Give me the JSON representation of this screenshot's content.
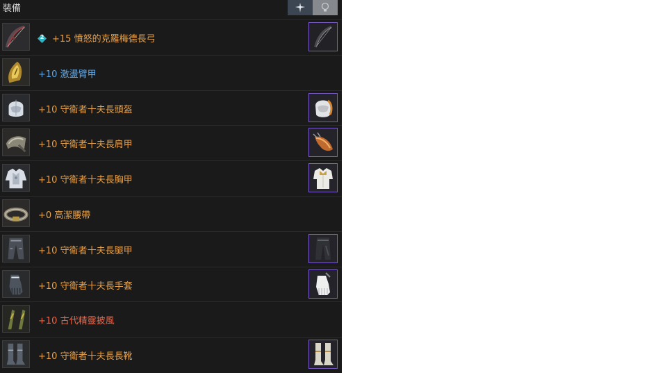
{
  "header": {
    "title": "裝備"
  },
  "tabs": [
    {
      "name": "weapon-icon"
    },
    {
      "name": "lightbulb-icon"
    }
  ],
  "colors": {
    "orange": "#e8a24a",
    "blue": "#5fa7e6",
    "red": "#f0684a",
    "badge": "#2bb6c6"
  },
  "equipment": [
    {
      "slot": "bow",
      "enhance_badge": "2",
      "label": "+15 憤怒的克羅梅德長弓",
      "color": "#e8a24a",
      "has_skin": true
    },
    {
      "slot": "bracer",
      "label": "+10 激盪臂甲",
      "color": "#5fa7e6",
      "has_skin": false
    },
    {
      "slot": "helmet",
      "label": "+10 守衛者十夫長頭盔",
      "color": "#e8a24a",
      "has_skin": true
    },
    {
      "slot": "shoulder",
      "label": "+10 守衛者十夫長肩甲",
      "color": "#e8a24a",
      "has_skin": true
    },
    {
      "slot": "chest",
      "label": "+10 守衛者十夫長胸甲",
      "color": "#e8a24a",
      "has_skin": true
    },
    {
      "slot": "belt",
      "label": "+0 高潔腰帶",
      "color": "#e8a24a",
      "has_skin": false
    },
    {
      "slot": "legs",
      "label": "+10 守衛者十夫長腿甲",
      "color": "#e8a24a",
      "has_skin": true
    },
    {
      "slot": "gloves",
      "label": "+10 守衛者十夫長手套",
      "color": "#e8a24a",
      "has_skin": true
    },
    {
      "slot": "cape",
      "label": "+10 古代精靈披風",
      "color": "#f0684a",
      "has_skin": false
    },
    {
      "slot": "boots",
      "label": "+10 守衛者十夫長長靴",
      "color": "#e8a24a",
      "has_skin": true
    }
  ]
}
